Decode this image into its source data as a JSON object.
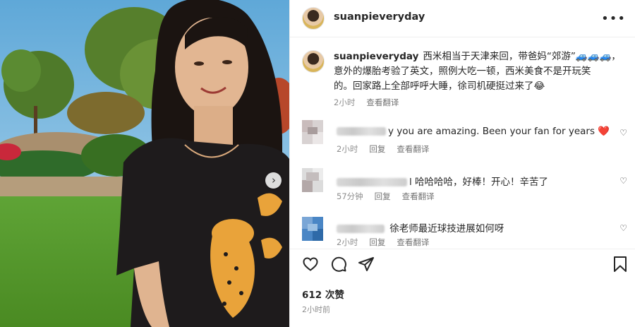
{
  "post": {
    "username": "suanpieveryday",
    "caption_line1": "西米相当于天津来回，带爸妈“郊游”🚙🚙🚙，",
    "caption_line2": "意外的爆胎考验了英文，照例大吃一顿，西米美食不是开玩笑",
    "caption_line3": "的。回家路上全部呼呼大睡，徐司机硬挺过来了😂",
    "caption_time": "2小时",
    "translate_label": "查看翻译"
  },
  "comments": [
    {
      "text": "y you are amazing. Been your fan for years",
      "emoji": "❤️",
      "time": "2小时",
      "reply_label": "回复",
      "translate_label": "查看翻译"
    },
    {
      "text": "l 哈哈哈哈，好棒！开心！辛苦了",
      "time": "57分钟",
      "reply_label": "回复",
      "translate_label": "查看翻译"
    },
    {
      "text": "徐老师最近球技进展如何呀",
      "time": "2小时",
      "reply_label": "回复",
      "translate_label": "查看翻译"
    }
  ],
  "likes_label": "612 次赞",
  "posted_time": "2小时前",
  "icons": {
    "more": "more-icon",
    "like": "heart-icon",
    "comment": "comment-icon",
    "share": "share-icon",
    "save": "bookmark-icon",
    "next": "chevron-right-icon",
    "comment_like": "heart-outline-icon"
  },
  "colors": {
    "red_heart": "#e0245e",
    "meta_gray": "#8e8e8e",
    "divider": "#efefef"
  }
}
